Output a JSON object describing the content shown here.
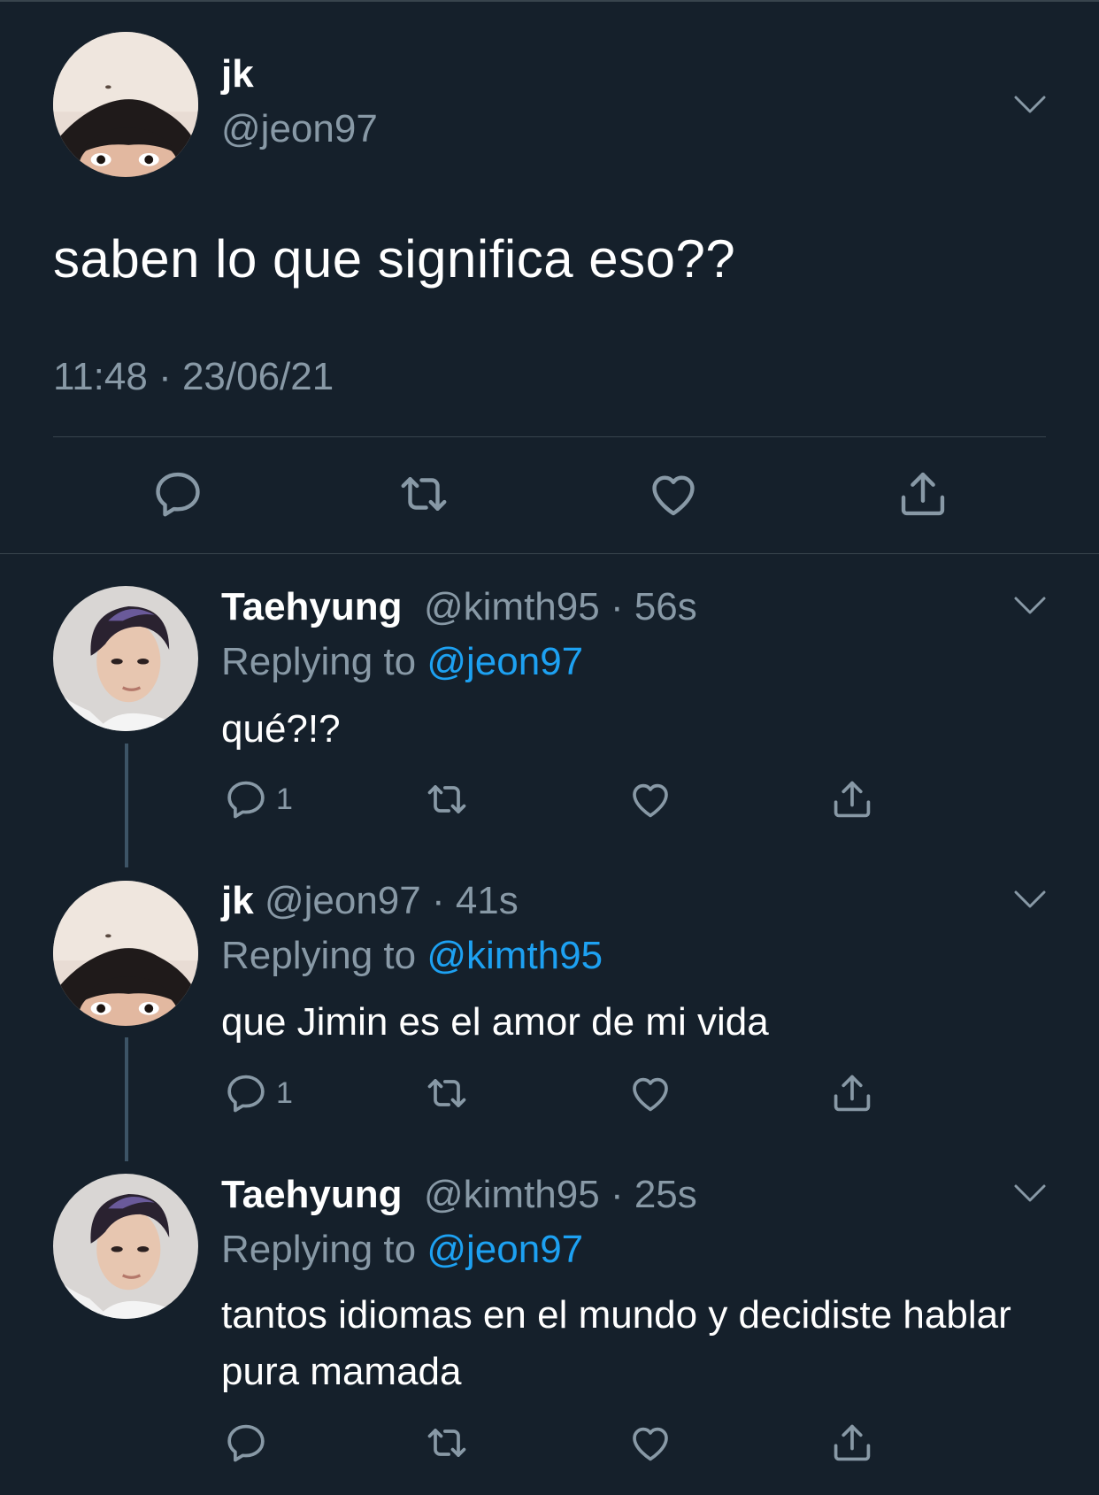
{
  "colors": {
    "background": "#15202b",
    "divider": "#38444d",
    "secondary_text": "#8899a6",
    "link": "#1da1f2",
    "thread_line": "#3d5466"
  },
  "main_tweet": {
    "name": "jk",
    "handle": "@jeon97",
    "text": "saben lo que significa eso??",
    "timestamp": "11:48 · 23/06/21",
    "actions": [
      "reply-icon",
      "retweet-icon",
      "like-icon",
      "share-icon"
    ]
  },
  "replies": [
    {
      "name": "Taehyung",
      "handle_time": "@kimth95 · 56s",
      "replying_prefix": "Replying to ",
      "replying_to": "@jeon97",
      "text": "qué?!?",
      "reply_count": "1"
    },
    {
      "name": "jk",
      "handle_time": "@jeon97 · 41s",
      "replying_prefix": "Replying to ",
      "replying_to": "@kimth95",
      "text": "que Jimin es el amor de mi vida",
      "reply_count": "1"
    },
    {
      "name": "Taehyung",
      "handle_time": "@kimth95 · 25s",
      "replying_prefix": "Replying to ",
      "replying_to": "@jeon97",
      "text": "tantos idiomas en el mundo y decidiste hablar pura mamada",
      "reply_count": ""
    }
  ]
}
